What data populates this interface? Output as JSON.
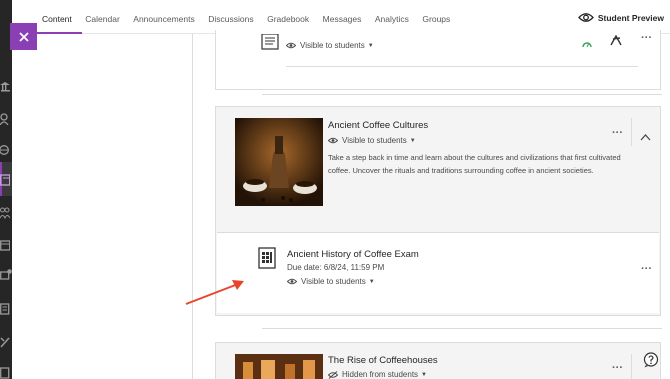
{
  "nav": {
    "tabs": [
      "Content",
      "Calendar",
      "Announcements",
      "Discussions",
      "Gradebook",
      "Messages",
      "Analytics",
      "Groups"
    ],
    "active_tab": "Content",
    "student_preview": "Student Preview"
  },
  "colors": {
    "accent": "#8a3fb5",
    "rail": "#262626",
    "arrow": "#e8452c"
  },
  "top_item": {
    "visibility": "Visible to students"
  },
  "module": {
    "title": "Ancient Coffee Cultures",
    "visibility": "Visible to students",
    "description": "Take a step back in time and learn about the cultures and civilizations that first cultivated coffee. Uncover the rituals and traditions surrounding coffee in ancient societies."
  },
  "exam": {
    "title": "Ancient History of Coffee Exam",
    "due": "Due date: 6/8/24, 11:59 PM",
    "visibility": "Visible to students"
  },
  "next_module": {
    "title": "The Rise of Coffeehouses",
    "visibility": "Hidden from students"
  },
  "more_label": "···",
  "rail_icons": [
    "institution-icon",
    "profile-icon",
    "globe-icon",
    "courses-icon",
    "organizations-icon",
    "calendar-icon",
    "messages-icon",
    "grades-icon",
    "tools-icon",
    "signout-icon"
  ]
}
